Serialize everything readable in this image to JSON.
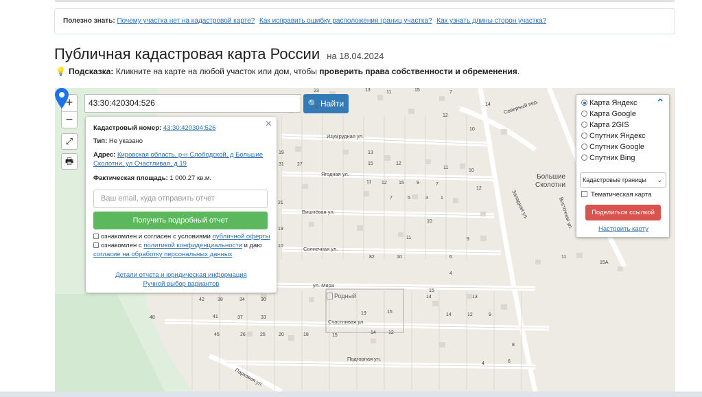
{
  "info_bar": {
    "label": "Полезно знать:",
    "links": [
      "Почему участка нет на кадастровой карте?",
      "Как исправить ошибку расположения границ участка?",
      "Как узнать длины сторон участка?"
    ]
  },
  "heading": {
    "title": "Публичная кадастровая карта России",
    "date": "на 18.04.2024"
  },
  "hint": {
    "label": "Подсказка:",
    "text": "Кликните на карте на любой участок или дом, чтобы",
    "bold": "проверить права собственности и обременения",
    "end": "."
  },
  "map": {
    "zoom_in": "+",
    "zoom_out": "−",
    "fullscreen_icon": "expand-icon",
    "print_icon": "printer-icon",
    "search_value": "43:30:420304:526",
    "search_button": "Найти",
    "marker_alt": "Родный",
    "town_label": [
      "Большие",
      "Сколотни"
    ],
    "streets": [
      "Изумрудная ул.",
      "Ягодная ул.",
      "Вишнёвая ул.",
      "Солнечная ул.",
      "ул. Мира",
      "Счастливая ул.",
      "Подгорная ул.",
      "Парковая ул.",
      "Северный пер.",
      "Западная ул.",
      "Восточная ул."
    ],
    "numbers": [
      "23",
      "13",
      "11",
      "15",
      "7",
      "14",
      "12",
      "10",
      "19",
      "13",
      "31",
      "27",
      "15",
      "12",
      "11",
      "10",
      "11",
      "12",
      "15",
      "9",
      "7",
      "12",
      "21",
      "7",
      "5",
      "3",
      "1",
      "19",
      "17",
      "11",
      "15",
      "10",
      "9",
      "7",
      "17",
      "10",
      "8",
      "19",
      "82",
      "10",
      "6",
      "4",
      "11",
      "15",
      "13",
      "46",
      "42",
      "38",
      "34",
      "30",
      "19",
      "14",
      "48",
      "41",
      "37",
      "33",
      "15",
      "14",
      "12",
      "9",
      "10",
      "45",
      "26",
      "25",
      "20",
      "18",
      "15",
      "14",
      "14",
      "12",
      "10",
      "15A",
      "8",
      "6",
      "4"
    ]
  },
  "popup": {
    "cadastral_label": "Кадастровый номер:",
    "cadastral_value": "43:30:420304:526",
    "type_label": "Тип:",
    "type_value": "Не указано",
    "address_label": "Адрес:",
    "address_line1": "Кировская область, р-н Слободской, д Большие",
    "address_line2": "Сколотни, ул Счастливая, д 19",
    "area_label": "Фактическая площадь:",
    "area_value": "1 000.27 кв.м.",
    "email_placeholder": "Ваш email, куда отправить отчет",
    "report_button": "Получить подробный отчет",
    "consent1_text": "ознакомлен и согласен с условиями",
    "consent1_link": "публичной оферты",
    "consent2_text": "ознакомлен с",
    "consent2_link": "политикой конфиденциальности",
    "consent2_mid": "и даю",
    "consent2_link2": "согласие на обработку персональных данных",
    "details_link": "Детали отчета и юридическая информация",
    "manual_link": "Ручной выбор вариантов",
    "close": "×"
  },
  "layers": {
    "options": [
      "Карта Яндекс",
      "Карта Google",
      "Карта 2GIS",
      "Спутник Яндекс",
      "Спутник Google",
      "Спутник Bing"
    ],
    "selected": "Карта Яндекс",
    "select_value": "Кадастровые границы",
    "thematic": "Тематическая карта",
    "share_button": "Поделиться ссылкой",
    "configure_link": "Настроить карту"
  },
  "colors": {
    "search_button": "#337ab7",
    "report_button": "#5cb85c",
    "share_button": "#d9534f",
    "marker": "#1a73e8",
    "link": "#2a6fb0"
  }
}
